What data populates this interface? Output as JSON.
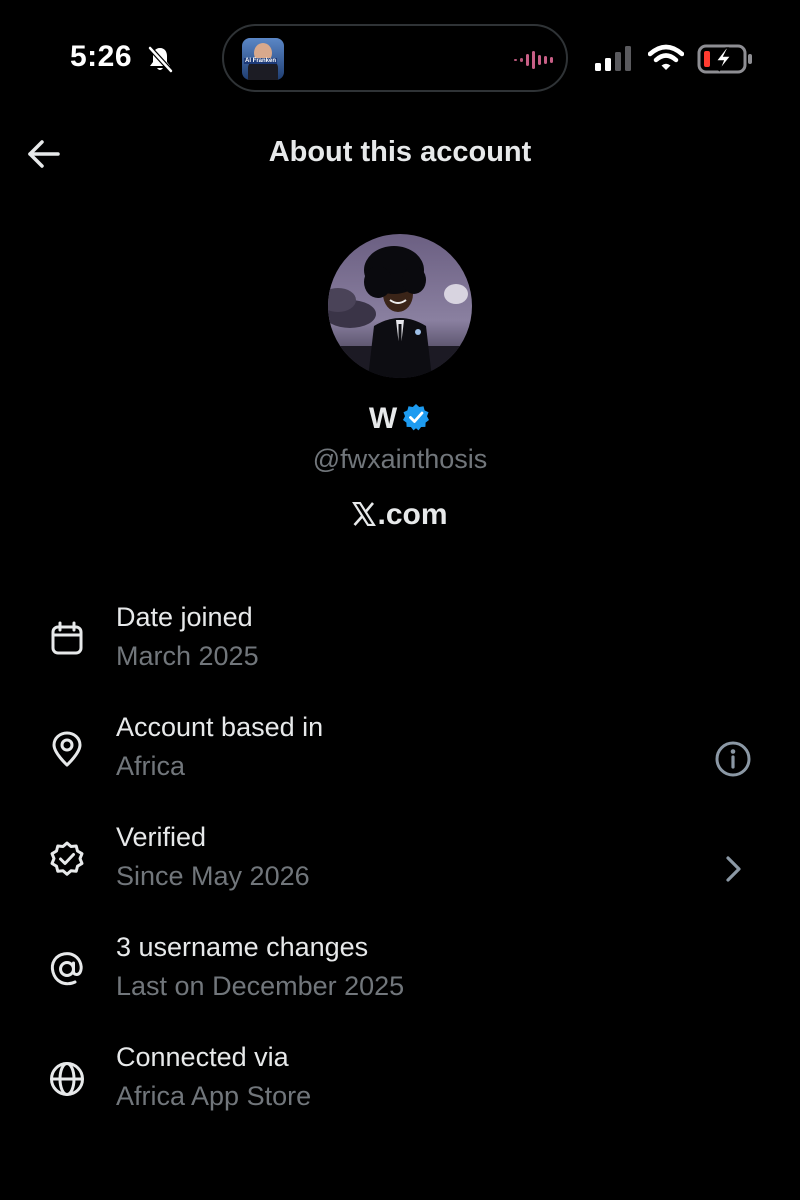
{
  "status_bar": {
    "time": "5:26",
    "island_thumb_label": "Al Franken"
  },
  "header": {
    "title": "About this account"
  },
  "profile": {
    "name": "W",
    "handle": "@fwxainthosis",
    "site_label": ".com"
  },
  "info": {
    "date_joined": {
      "title": "Date joined",
      "value": "March 2025"
    },
    "location": {
      "title": "Account based in",
      "value": "Africa"
    },
    "verified": {
      "title": "Verified",
      "value": "Since May 2026"
    },
    "username_changes": {
      "title": "3 username changes",
      "value": "Last on December 2025"
    },
    "connected_via": {
      "title": "Connected via",
      "value": "Africa App Store"
    }
  },
  "colors": {
    "background": "#000000",
    "primary_text": "#e7e9ea",
    "secondary_text": "#71767b",
    "verified_blue": "#1d9bf0",
    "battery_low": "#ff3b30"
  }
}
